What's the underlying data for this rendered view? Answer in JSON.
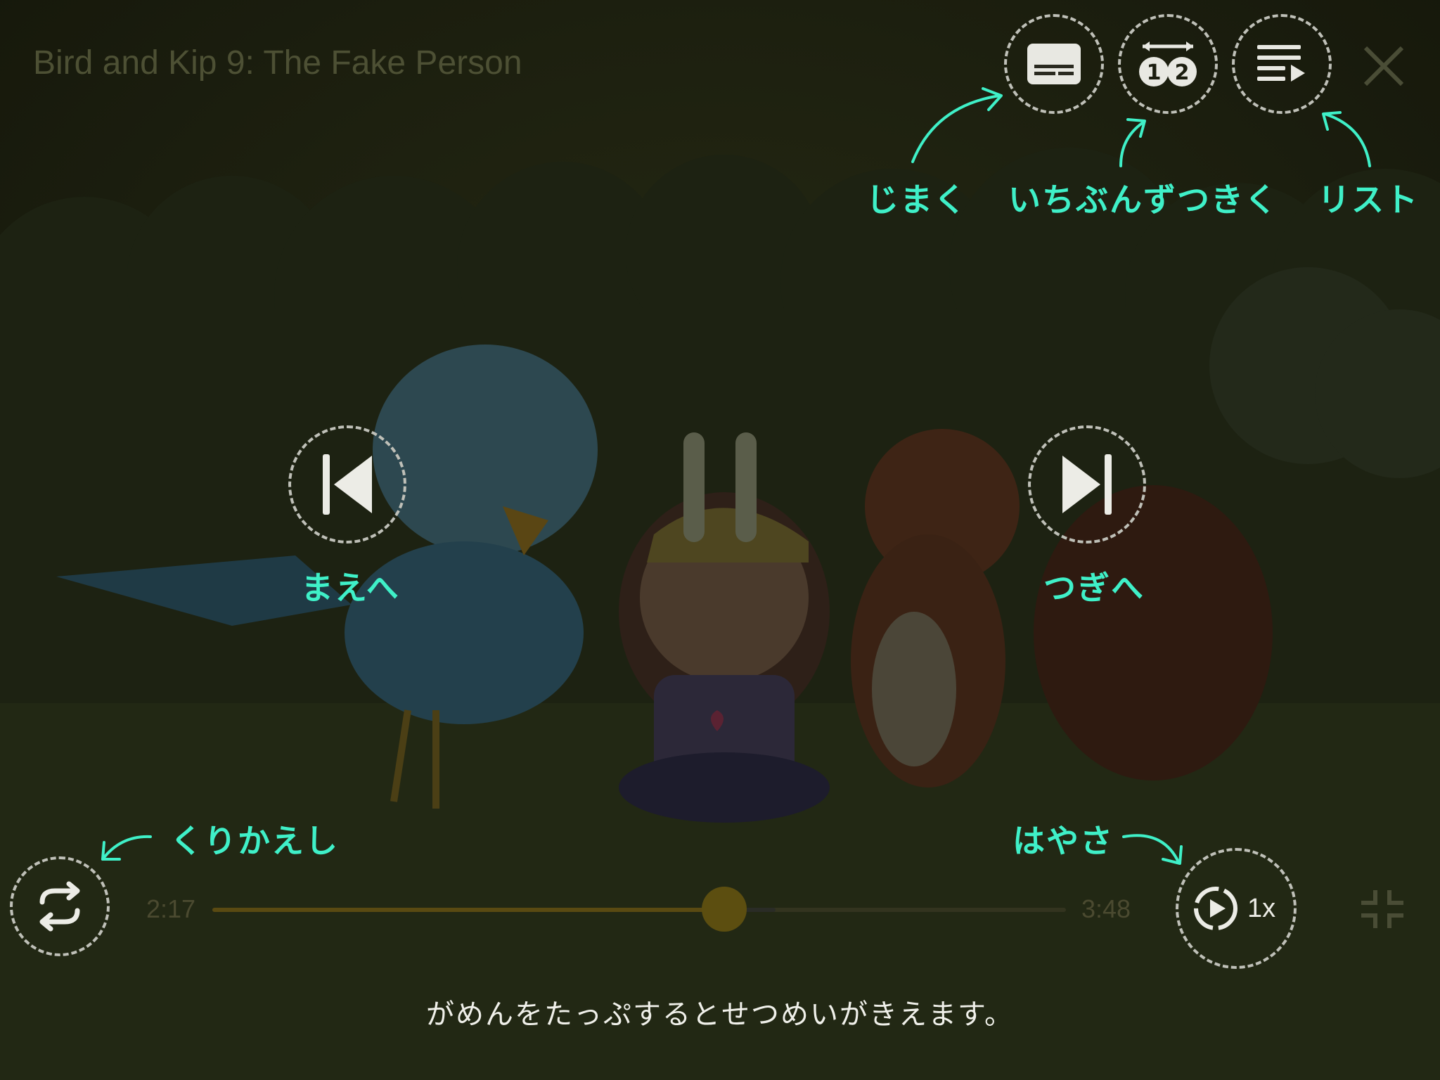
{
  "player": {
    "title": "Bird and Kip 9: The Fake Person",
    "current_time": "2:17",
    "duration": "3:48",
    "progress": 0.5994,
    "buffered": 0.66,
    "speed": "1x",
    "subtitle": "がめんをたっぷするとせつめいがきえます。"
  },
  "help_labels": {
    "subtitles": "じまく",
    "sentence_by_sentence": "いちぶんずつきく",
    "list": "リスト",
    "previous": "まえへ",
    "next": "つぎへ",
    "repeat": "くりかえし",
    "speed": "はやさ"
  },
  "icons": {
    "subtitles": "subtitles-icon",
    "sentence_mode": "sentence-mode-icon",
    "playlist": "playlist-icon",
    "close": "close-icon",
    "previous": "skip-previous-icon",
    "next": "skip-next-icon",
    "pause": "pause-icon",
    "repeat": "repeat-icon",
    "speed": "playback-speed-icon",
    "minimize": "exit-fullscreen-icon"
  },
  "colors": {
    "accent": "#3ff0c8",
    "progress_fill": "#5a4a12",
    "progress_thumb": "#5c4e10",
    "dim_icon": "#4a4d36"
  }
}
